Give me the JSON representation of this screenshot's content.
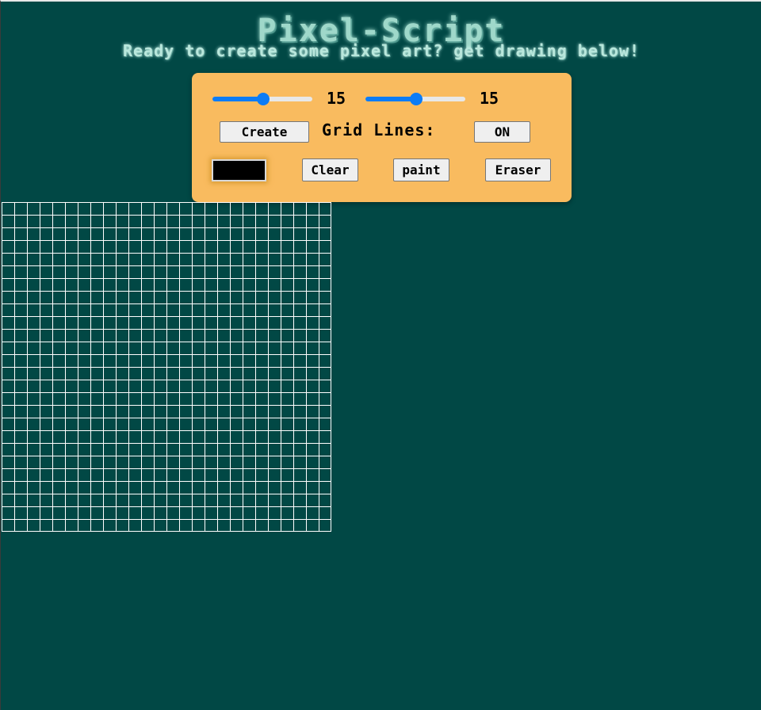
{
  "header": {
    "title": "Pixel-Script",
    "subtitle": "Ready to create some pixel art? get drawing below!"
  },
  "controls": {
    "width_slider": {
      "value": 15,
      "min": 1,
      "max": 30
    },
    "height_slider": {
      "value": 15,
      "min": 1,
      "max": 30
    },
    "width_value": "15",
    "height_value": "15",
    "create_label": "Create",
    "grid_lines_label": "Grid Lines:",
    "grid_lines_toggle": "ON",
    "color_value": "#000000",
    "clear_label": "Clear",
    "paint_label": "paint",
    "eraser_label": "Eraser"
  },
  "colors": {
    "background": "#014845",
    "panel": "#f9bb5f",
    "accent": "#0b7cf6",
    "grid_line": "#ffffff"
  },
  "canvas": {
    "columns": 26,
    "rows": 26,
    "grid_lines": true
  }
}
